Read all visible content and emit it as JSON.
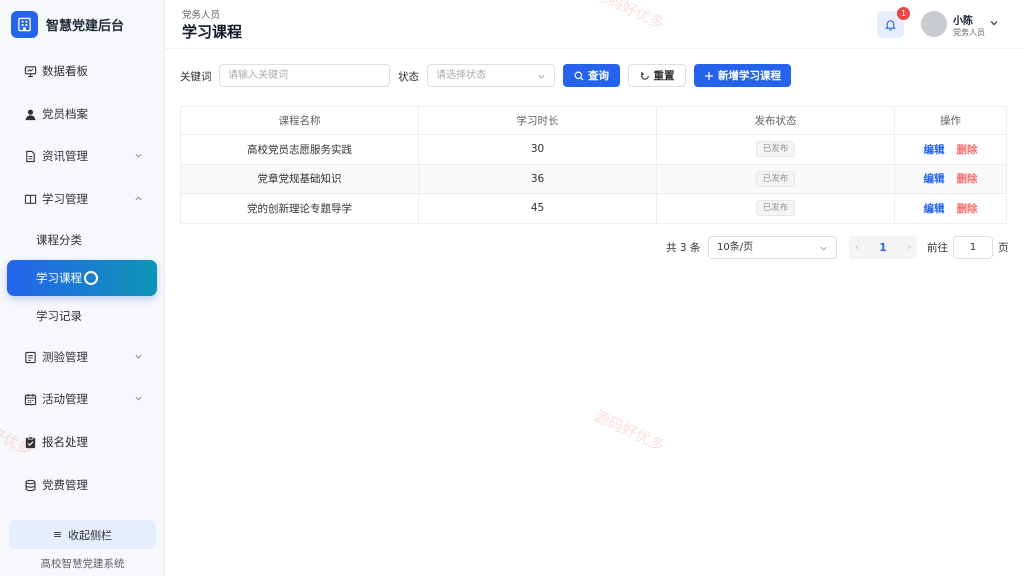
{
  "brand": {
    "title": "智慧党建后台"
  },
  "sidebar": {
    "items": [
      {
        "label": "数据看板",
        "icon": "monitor-icon",
        "has_chevron": false
      },
      {
        "label": "党员档案",
        "icon": "user-icon",
        "has_chevron": false
      },
      {
        "label": "资讯管理",
        "icon": "document-icon",
        "has_chevron": true,
        "expanded": false
      },
      {
        "label": "学习管理",
        "icon": "book-icon",
        "has_chevron": true,
        "expanded": true
      },
      {
        "label": "课程分类",
        "sub": true
      },
      {
        "label": "学习课程",
        "sub": true,
        "active": true
      },
      {
        "label": "学习记录",
        "sub": true
      },
      {
        "label": "测验管理",
        "icon": "list-icon",
        "has_chevron": true,
        "expanded": false
      },
      {
        "label": "活动管理",
        "icon": "calendar-icon",
        "has_chevron": true,
        "expanded": false
      },
      {
        "label": "报名处理",
        "icon": "clipboard-check-icon",
        "has_chevron": false
      },
      {
        "label": "党费管理",
        "icon": "database-icon",
        "has_chevron": false
      }
    ],
    "collapse_label": "收起侧栏",
    "footer": "高校智慧党建系统"
  },
  "header": {
    "breadcrumb": "党务人员",
    "title": "学习课程",
    "notification_count": "1",
    "user_name": "小陈",
    "user_role": "党务人员"
  },
  "filters": {
    "keyword_label": "关键词",
    "keyword_placeholder": "请输入关键词",
    "status_label": "状态",
    "status_placeholder": "请选择状态",
    "search_label": "查询",
    "reset_label": "重置",
    "add_label": "新增学习课程"
  },
  "table": {
    "columns": [
      "课程名称",
      "学习时长",
      "发布状态",
      "操作"
    ],
    "rows": [
      {
        "name": "高校党员志愿服务实践",
        "duration": "30",
        "status": "已发布"
      },
      {
        "name": "党章党规基础知识",
        "duration": "36",
        "status": "已发布"
      },
      {
        "name": "党的创新理论专题导学",
        "duration": "45",
        "status": "已发布"
      }
    ],
    "edit_label": "编辑",
    "delete_label": "删除"
  },
  "pagination": {
    "total": "共 3 条",
    "page_size": "10条/页",
    "current_page": "1",
    "goto_label": "前往",
    "goto_value": "1",
    "goto_unit": "页"
  },
  "watermark": "源码好优多",
  "colors": {
    "primary": "#2563eb",
    "danger": "#f56c6c",
    "gradient_end": "#0e96b6"
  }
}
